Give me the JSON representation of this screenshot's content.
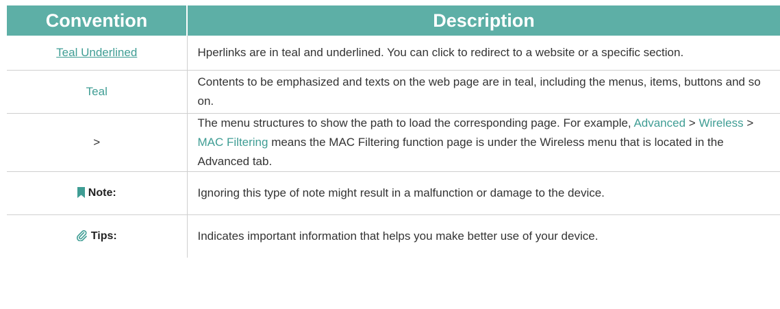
{
  "table": {
    "headers": {
      "convention": "Convention",
      "description": "Description"
    },
    "rows": [
      {
        "convention": "Teal Underlined",
        "description": "Hperlinks are in teal and underlined. You can click to redirect to a website or a specific section."
      },
      {
        "convention": "Teal",
        "description": "Contents to be emphasized and texts on the web page are in teal, including the menus, items, buttons and so on."
      },
      {
        "convention": ">",
        "description_part1": "The menu structures to show the path to load the corresponding page. For example, ",
        "path_1": "Advanced",
        "sep_1": " > ",
        "path_2": "Wireless",
        "sep_2": " > ",
        "path_3": "MAC Filtering",
        "description_part2": " means the MAC Filtering function page is under the Wireless menu that is located in the Advanced tab."
      },
      {
        "convention": "Note:",
        "icon": "bookmark-icon",
        "description": "Ignoring this type of note might result in a malfunction or damage to the device."
      },
      {
        "convention": "Tips:",
        "icon": "paperclip-icon",
        "description": "Indicates important information that helps you make better use of your device."
      }
    ]
  },
  "colors": {
    "header_bg": "#5dafa6",
    "teal_text": "#3f9d94",
    "border": "#cfcfcf"
  }
}
